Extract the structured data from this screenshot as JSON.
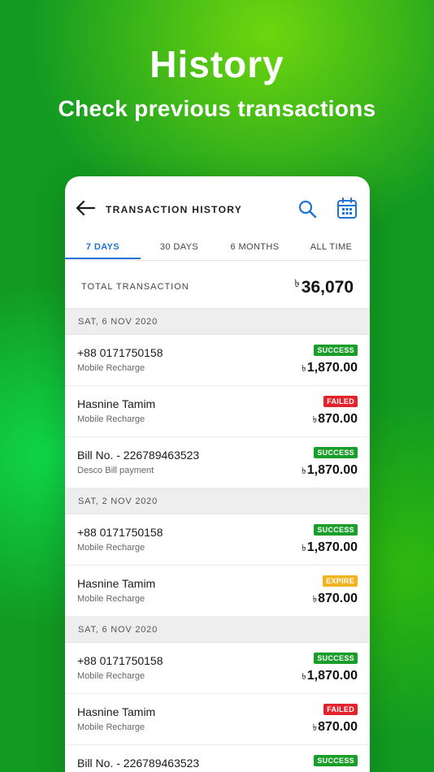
{
  "hero": {
    "title": "History",
    "subtitle": "Check previous transactions"
  },
  "colors": {
    "accent": "#1f73d6",
    "success": "#1a9e2a",
    "failed": "#e3232c",
    "expire": "#f2b321",
    "background_green": "#129a22"
  },
  "appbar": {
    "title": "TRANSACTION HISTORY",
    "back_icon": "arrow-left-icon",
    "search_icon": "search-icon",
    "calendar_icon": "calendar-icon"
  },
  "tabs": [
    {
      "label": "7 DAYS",
      "active": true
    },
    {
      "label": "30 DAYS",
      "active": false
    },
    {
      "label": "6 MONTHS",
      "active": false
    },
    {
      "label": "ALL TIME",
      "active": false
    }
  ],
  "total": {
    "label": "TOTAL TRANSACTION",
    "currency": "৳",
    "amount": "36,070"
  },
  "groups": [
    {
      "date": "SAT, 6 NOV 2020",
      "items": [
        {
          "name": "+88 0171750158",
          "type": "Mobile Recharge",
          "status": "SUCCESS",
          "currency": "৳",
          "amount": "1,870.00"
        },
        {
          "name": "Hasnine Tamim",
          "type": "Mobile Recharge",
          "status": "FAILED",
          "currency": "৳",
          "amount": "870.00"
        },
        {
          "name": "Bill No. - 226789463523",
          "type": "Desco Bill payment",
          "status": "SUCCESS",
          "currency": "৳",
          "amount": "1,870.00"
        }
      ]
    },
    {
      "date": "SAT, 2 NOV 2020",
      "items": [
        {
          "name": "+88 0171750158",
          "type": "Mobile Recharge",
          "status": "SUCCESS",
          "currency": "৳",
          "amount": "1,870.00"
        },
        {
          "name": "Hasnine Tamim",
          "type": "Mobile Recharge",
          "status": "EXPIRE",
          "currency": "৳",
          "amount": "870.00"
        }
      ]
    },
    {
      "date": "SAT, 6 NOV 2020",
      "items": [
        {
          "name": "+88 0171750158",
          "type": "Mobile Recharge",
          "status": "SUCCESS",
          "currency": "৳",
          "amount": "1,870.00"
        },
        {
          "name": "Hasnine Tamim",
          "type": "Mobile Recharge",
          "status": "FAILED",
          "currency": "৳",
          "amount": "870.00"
        },
        {
          "name": "Bill No. - 226789463523",
          "type": "",
          "status": "SUCCESS",
          "currency": "",
          "amount": ""
        }
      ]
    }
  ]
}
